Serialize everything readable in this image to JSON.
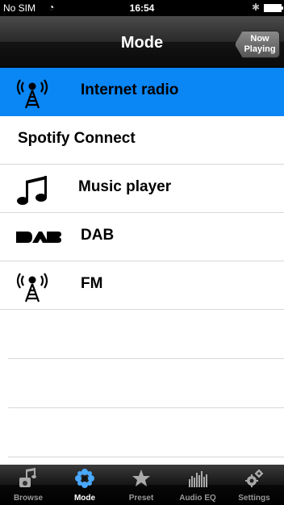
{
  "status": {
    "carrier": "No SIM",
    "time": "16:54"
  },
  "nav": {
    "title": "Mode",
    "now_playing_line1": "Now",
    "now_playing_line2": "Playing"
  },
  "modes": [
    {
      "label": "Internet radio",
      "icon": "radio-tower-icon",
      "selected": true
    },
    {
      "label": "Spotify Connect",
      "icon": "none",
      "selected": false
    },
    {
      "label": "Music player",
      "icon": "music-notes-icon",
      "selected": false
    },
    {
      "label": "DAB",
      "icon": "dab-logo-icon",
      "selected": false
    },
    {
      "label": "FM",
      "icon": "radio-tower-icon",
      "selected": false
    }
  ],
  "tabs": [
    {
      "label": "Browse",
      "icon": "browse-icon",
      "active": false
    },
    {
      "label": "Mode",
      "icon": "mode-icon",
      "active": true
    },
    {
      "label": "Preset",
      "icon": "star-icon",
      "active": false
    },
    {
      "label": "Audio EQ",
      "icon": "equalizer-icon",
      "active": false
    },
    {
      "label": "Settings",
      "icon": "gear-icon",
      "active": false
    }
  ],
  "colors": {
    "selected_row": "#0a86f5",
    "active_tab_icon": "#4aa8ff"
  }
}
